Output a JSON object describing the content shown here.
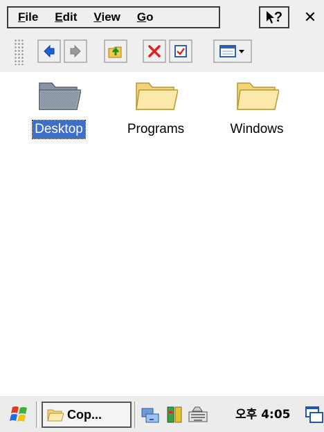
{
  "menu": {
    "items": [
      {
        "label": "File",
        "mnemonic": "F",
        "rest": "ile"
      },
      {
        "label": "Edit",
        "mnemonic": "E",
        "rest": "dit"
      },
      {
        "label": "View",
        "mnemonic": "V",
        "rest": "iew"
      },
      {
        "label": "Go",
        "mnemonic": "G",
        "rest": "o"
      }
    ],
    "help_label": "?",
    "close_label": "✕"
  },
  "toolbar": {
    "buttons": [
      "back-icon",
      "forward-icon",
      "up-folder-icon",
      "delete-icon",
      "properties-icon",
      "view-mode-icon"
    ]
  },
  "files": [
    {
      "name": "Desktop",
      "selected": true,
      "icon": "desktop-folder-icon"
    },
    {
      "name": "Programs",
      "selected": false,
      "icon": "folder-icon"
    },
    {
      "name": "Windows",
      "selected": false,
      "icon": "folder-icon"
    }
  ],
  "taskbar": {
    "task_label": "Cop...",
    "clock": "오후 4:05"
  },
  "colors": {
    "selection": "#3d6ec9",
    "folder": "#f6e08c",
    "chrome": "#efefef"
  }
}
